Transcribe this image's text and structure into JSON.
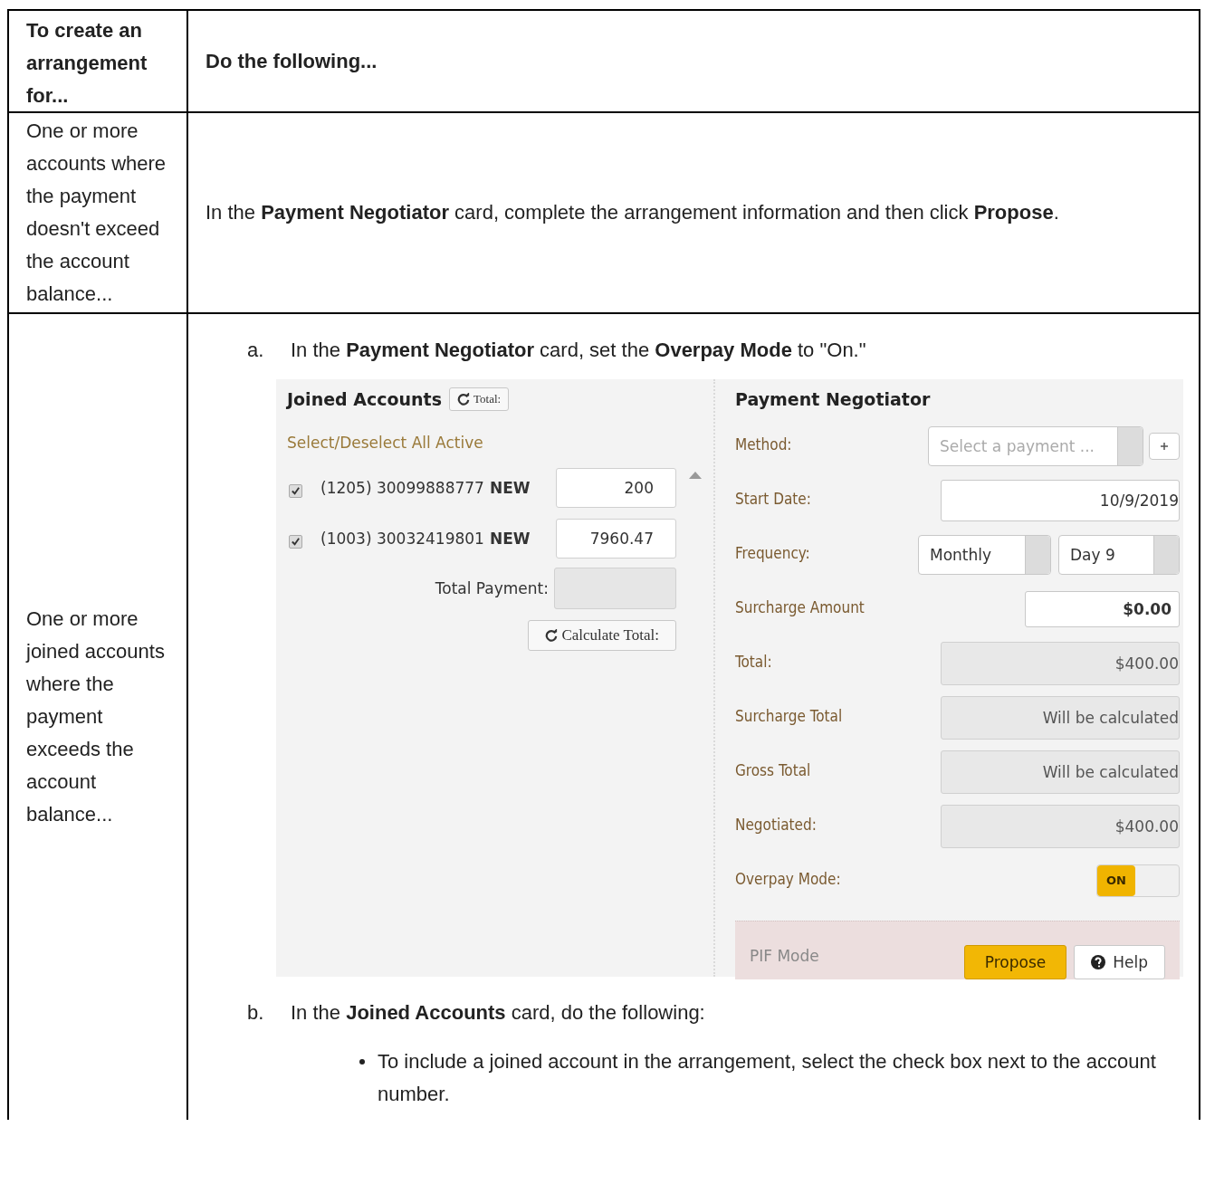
{
  "table": {
    "columns": [
      "To create an arrangement for...",
      "Do the following..."
    ],
    "rows": [
      {
        "case": "One or more accounts where the payment doesn't exceed the account balance...",
        "paragraphs": [
          "In the **Payment Negotiator** card, complete the arrangement information and then click **Propose**."
        ]
      },
      {
        "case": "One or more joined accounts where the payment exceeds the account balance...",
        "steps": [
          {
            "marker": "a.",
            "text": "In the **Payment Negotiator** card, set the **Overpay Mode** to \"On.\"",
            "screenshot": {
              "joined": {
                "title": "Joined Accounts",
                "total_button": "Total:",
                "select_all": "Select/Deselect All Active",
                "accounts": [
                  {
                    "label": "(1205) 30099888777",
                    "badge": "NEW",
                    "checked": true,
                    "amount": "200"
                  },
                  {
                    "label": "(1003) 30032419801",
                    "badge": "NEW",
                    "checked": true,
                    "amount": "7960.47"
                  }
                ],
                "total_label": "Total Payment:",
                "calculate_button": "Calculate Total:"
              },
              "negotiator": {
                "title": "Payment Negotiator",
                "fields": [
                  {
                    "kind": "select_add",
                    "label": "Method:",
                    "placeholder": "Select a payment ..."
                  },
                  {
                    "kind": "input",
                    "label": "Start Date:",
                    "value": "10/9/2019"
                  },
                  {
                    "kind": "double_select",
                    "label": "Frequency:",
                    "values": [
                      "Monthly",
                      "Day 9"
                    ]
                  },
                  {
                    "kind": "short_input",
                    "label": "Surcharge Amount",
                    "value": "$0.00"
                  },
                  {
                    "kind": "readonly",
                    "label": "Total:",
                    "value": "$400.00"
                  },
                  {
                    "kind": "readonly",
                    "label": "Surcharge Total",
                    "value": "Will be calculated"
                  },
                  {
                    "kind": "readonly",
                    "label": "Gross Total",
                    "value": "Will be calculated"
                  },
                  {
                    "kind": "readonly",
                    "label": "Negotiated:",
                    "value": "$400.00"
                  },
                  {
                    "kind": "toggle",
                    "label": "Overpay Mode:",
                    "on": true,
                    "text": "ON"
                  }
                ],
                "pif": {
                  "label": "PIF Mode",
                  "buttons": [
                    {
                      "kind": "primary",
                      "label": "Propose"
                    },
                    {
                      "kind": "help",
                      "label": "Help"
                    }
                  ]
                }
              }
            }
          },
          {
            "marker": "b.",
            "text": "In the **Joined Accounts** card, do the following:",
            "bullets": [
              "To include a joined account in the arrangement, select the check box next to the account number."
            ]
          }
        ]
      }
    ]
  }
}
